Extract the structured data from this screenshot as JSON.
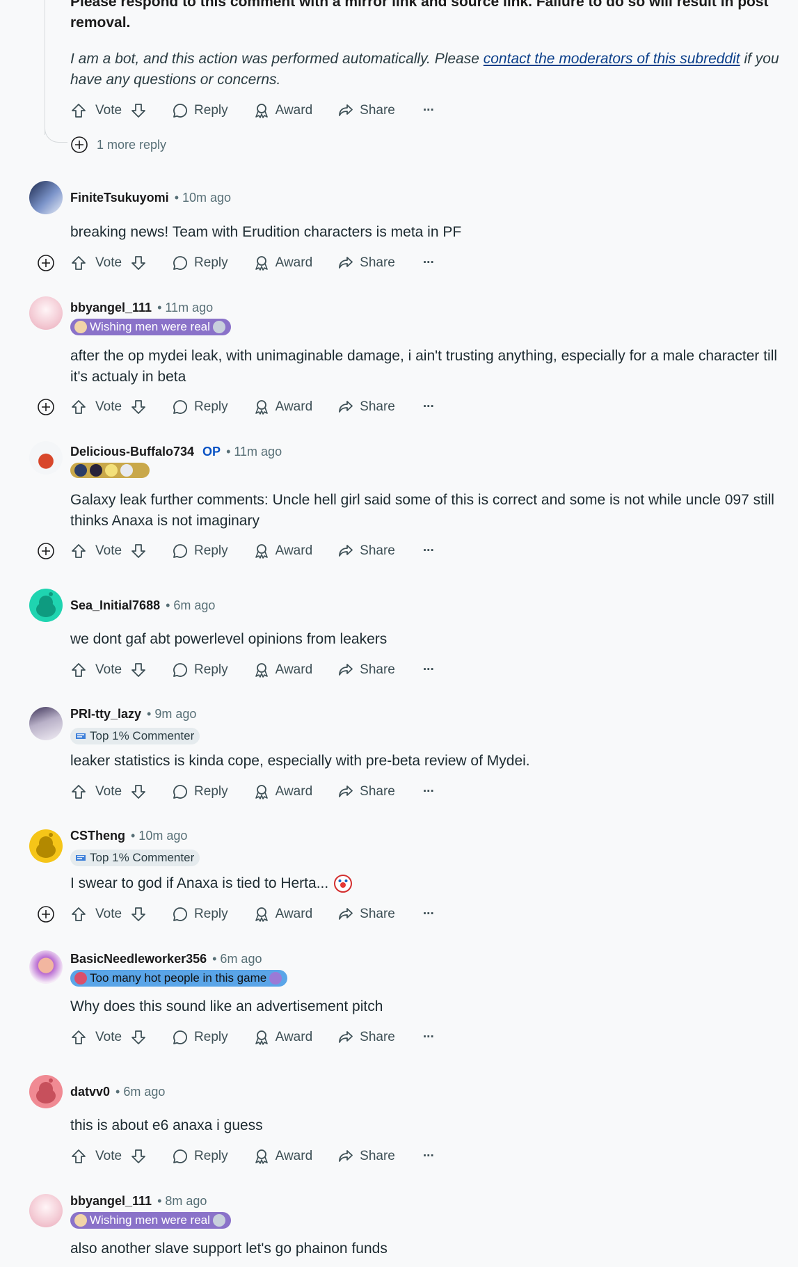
{
  "bot": {
    "bold_text": "Please respond to this comment with a mirror link and source link. Failure to do so will result in post removal.",
    "italic_pre": "I am a bot, and this action was performed automatically. Please ",
    "link_text": "contact the moderators of this subreddit",
    "italic_post": " if you have any questions or concerns.",
    "more_reply": "1 more reply"
  },
  "labels": {
    "vote": "Vote",
    "reply": "Reply",
    "award": "Award",
    "share": "Share",
    "more": "···"
  },
  "comments": [
    {
      "user": "FiniteTsukuyomi",
      "time": "• 10m ago",
      "body": "breaking news! Team with Erudition characters is meta in PF",
      "avatar_color": "#4a5f8c"
    },
    {
      "user": "bbyangel_111",
      "time": "• 11m ago",
      "flair": "Wishing men were real",
      "body": "after the op mydei leak, with unimaginable damage, i ain't trusting anything, especially for a male character till it's actualy in beta",
      "avatar_color": "#f3c9d3"
    },
    {
      "user": "Delicious-Buffalo734",
      "op": "OP",
      "time": "• 11m ago",
      "body": "Galaxy leak further comments: Uncle hell girl said some of this is correct and some is not while uncle 097 still thinks Anaxa is not imaginary",
      "avatar_color": "#e8eef2"
    },
    {
      "user": "Sea_Initial7688",
      "time": "• 6m ago",
      "body": "we dont gaf abt powerlevel opinions from leakers",
      "avatar_color": "#1fd4b0"
    },
    {
      "user": "PRI-tty_lazy",
      "time": "• 9m ago",
      "flair": "Top 1% Commenter",
      "body": "leaker statistics is kinda cope, especially with pre-beta review of Mydei.",
      "avatar_color": "#8c8299"
    },
    {
      "user": "CSTheng",
      "time": "• 10m ago",
      "flair": "Top 1% Commenter",
      "body": "I swear to god if Anaxa is tied to Herta...",
      "avatar_color": "#f5c518"
    },
    {
      "user": "BasicNeedleworker356",
      "time": "• 6m ago",
      "flair": "Too many hot people in this game",
      "body": "Why does this sound like an advertisement pitch",
      "avatar_color": "#b86ad1"
    },
    {
      "user": "datvv0",
      "time": "• 6m ago",
      "body": "this is about e6 anaxa i guess",
      "avatar_color": "#f08a93"
    },
    {
      "user": "bbyangel_111",
      "time": "• 8m ago",
      "flair": "Wishing men were real",
      "body": "also another slave support let's go phainon funds",
      "avatar_color": "#f3c9d3"
    }
  ]
}
